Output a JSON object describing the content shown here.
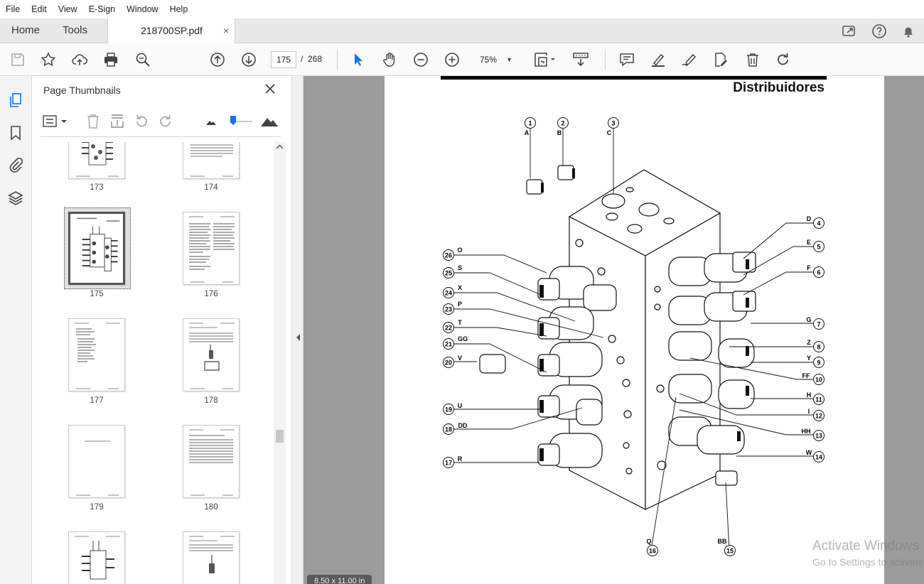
{
  "menu": [
    "File",
    "Edit",
    "View",
    "E-Sign",
    "Window",
    "Help"
  ],
  "tabs": {
    "home": "Home",
    "tools": "Tools",
    "document": "218700SP.pdf",
    "close_glyph": "×"
  },
  "toolbar": {
    "current_page": "175",
    "page_separator": "/",
    "total_pages": "268",
    "zoom": "75%"
  },
  "panel": {
    "title": "Page Thumbnails",
    "thumbnails": [
      {
        "label": "173",
        "kind": "diagram"
      },
      {
        "label": "174",
        "kind": "table"
      },
      {
        "label": "175",
        "kind": "diagram",
        "selected": true
      },
      {
        "label": "176",
        "kind": "text"
      },
      {
        "label": "177",
        "kind": "text"
      },
      {
        "label": "178",
        "kind": "diagram"
      },
      {
        "label": "179",
        "kind": "blank"
      },
      {
        "label": "180",
        "kind": "table"
      },
      {
        "label": "",
        "kind": "diagram"
      },
      {
        "label": "",
        "kind": "diagram"
      }
    ]
  },
  "document": {
    "title": "Distribuidores",
    "page_size": "8.50 x 11.00 in",
    "callouts_left": [
      {
        "num": "26",
        "letter": "O"
      },
      {
        "num": "25",
        "letter": "S"
      },
      {
        "num": "24",
        "letter": "X"
      },
      {
        "num": "23",
        "letter": "P"
      },
      {
        "num": "22",
        "letter": "T"
      },
      {
        "num": "21",
        "letter": "GG"
      },
      {
        "num": "20",
        "letter": "V"
      },
      {
        "num": "19",
        "letter": "U"
      },
      {
        "num": "18",
        "letter": "DD"
      },
      {
        "num": "17",
        "letter": "R"
      }
    ],
    "callouts_right": [
      {
        "num": "4",
        "letter": "D"
      },
      {
        "num": "5",
        "letter": "E"
      },
      {
        "num": "6",
        "letter": "F"
      },
      {
        "num": "7",
        "letter": "G"
      },
      {
        "num": "8",
        "letter": "Z"
      },
      {
        "num": "9",
        "letter": "Y"
      },
      {
        "num": "10",
        "letter": "FF"
      },
      {
        "num": "11",
        "letter": "H"
      },
      {
        "num": "12",
        "letter": "I"
      },
      {
        "num": "13",
        "letter": "HH"
      },
      {
        "num": "14",
        "letter": "W"
      }
    ],
    "callouts_top": [
      {
        "num": "1",
        "letter": "A"
      },
      {
        "num": "2",
        "letter": "B"
      },
      {
        "num": "3",
        "letter": "C"
      }
    ],
    "callouts_bottom": [
      {
        "num": "16",
        "letter": "Q"
      },
      {
        "num": "15",
        "letter": "BB"
      }
    ]
  },
  "watermark": {
    "line1": "Activate Windows",
    "line2": "Go to Settings to activate Windows."
  },
  "icons": {
    "tabbar": [
      "share-icon",
      "help-icon",
      "bell-icon"
    ],
    "toolbar": [
      "save-icon",
      "bookmark-star-icon",
      "upload-icon",
      "print-icon",
      "zoom-search-icon",
      "page-up-icon",
      "page-down-icon",
      "select-cursor-icon",
      "hand-icon",
      "zoom-out-icon",
      "zoom-in-icon",
      "fit-page-icon",
      "scroll-mode-icon",
      "comment-icon",
      "highlight-icon",
      "sign-icon",
      "edit-pdf-icon",
      "delete-icon",
      "rotate-icon"
    ],
    "leftrail": [
      "pages-icon",
      "bookmark-icon",
      "attachment-icon",
      "layers-icon"
    ]
  },
  "colors": {
    "accent": "#1473e6",
    "viewer_bg": "#9b9b9b",
    "tabbar_bg": "#e8e8e8"
  }
}
